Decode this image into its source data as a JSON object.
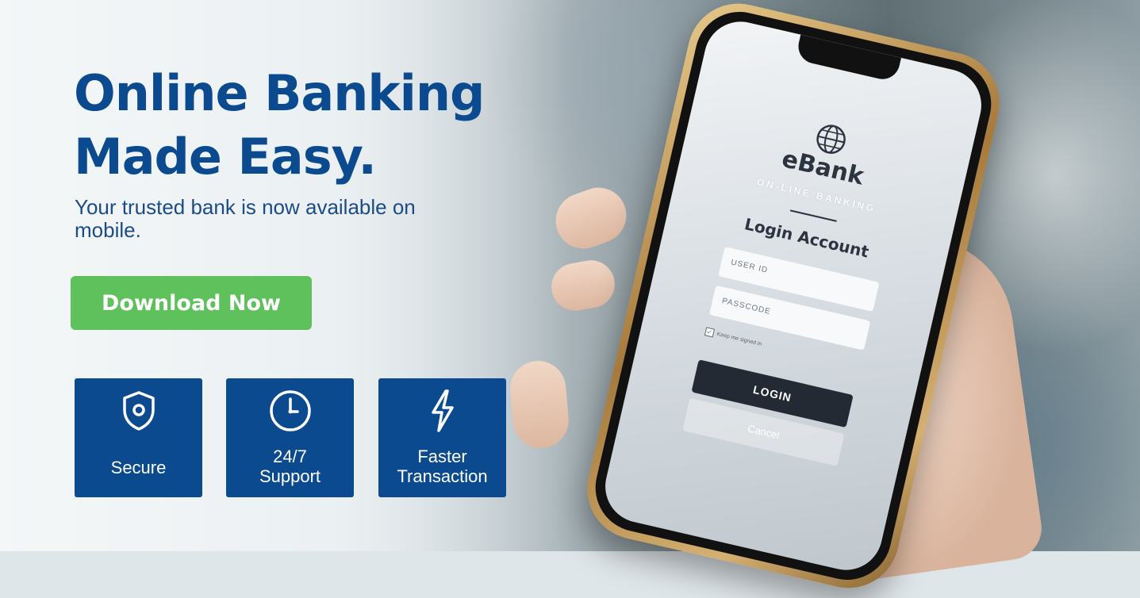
{
  "hero": {
    "title_line1": "Online Banking",
    "title_line2": "Made Easy.",
    "subtitle": "Your trusted bank is now available on mobile.",
    "cta_label": "Download Now"
  },
  "features": [
    {
      "label": "Secure",
      "icon": "shield-icon"
    },
    {
      "label": "24/7\nSupport",
      "icon": "clock-icon"
    },
    {
      "label": "Faster\nTransaction",
      "icon": "lightning-icon"
    }
  ],
  "phone_screen": {
    "app_name": "eBank",
    "app_tagline": "ON-LINE BANKING",
    "heading": "Login Account",
    "user_id_placeholder": "USER ID",
    "passcode_placeholder": "PASSCODE",
    "keep_signed_in": "Keep me signed in",
    "login_label": "LOGIN",
    "cancel_label": "Cancel"
  },
  "colors": {
    "brand_blue": "#0b4a8f",
    "cta_green": "#5fc15b"
  }
}
